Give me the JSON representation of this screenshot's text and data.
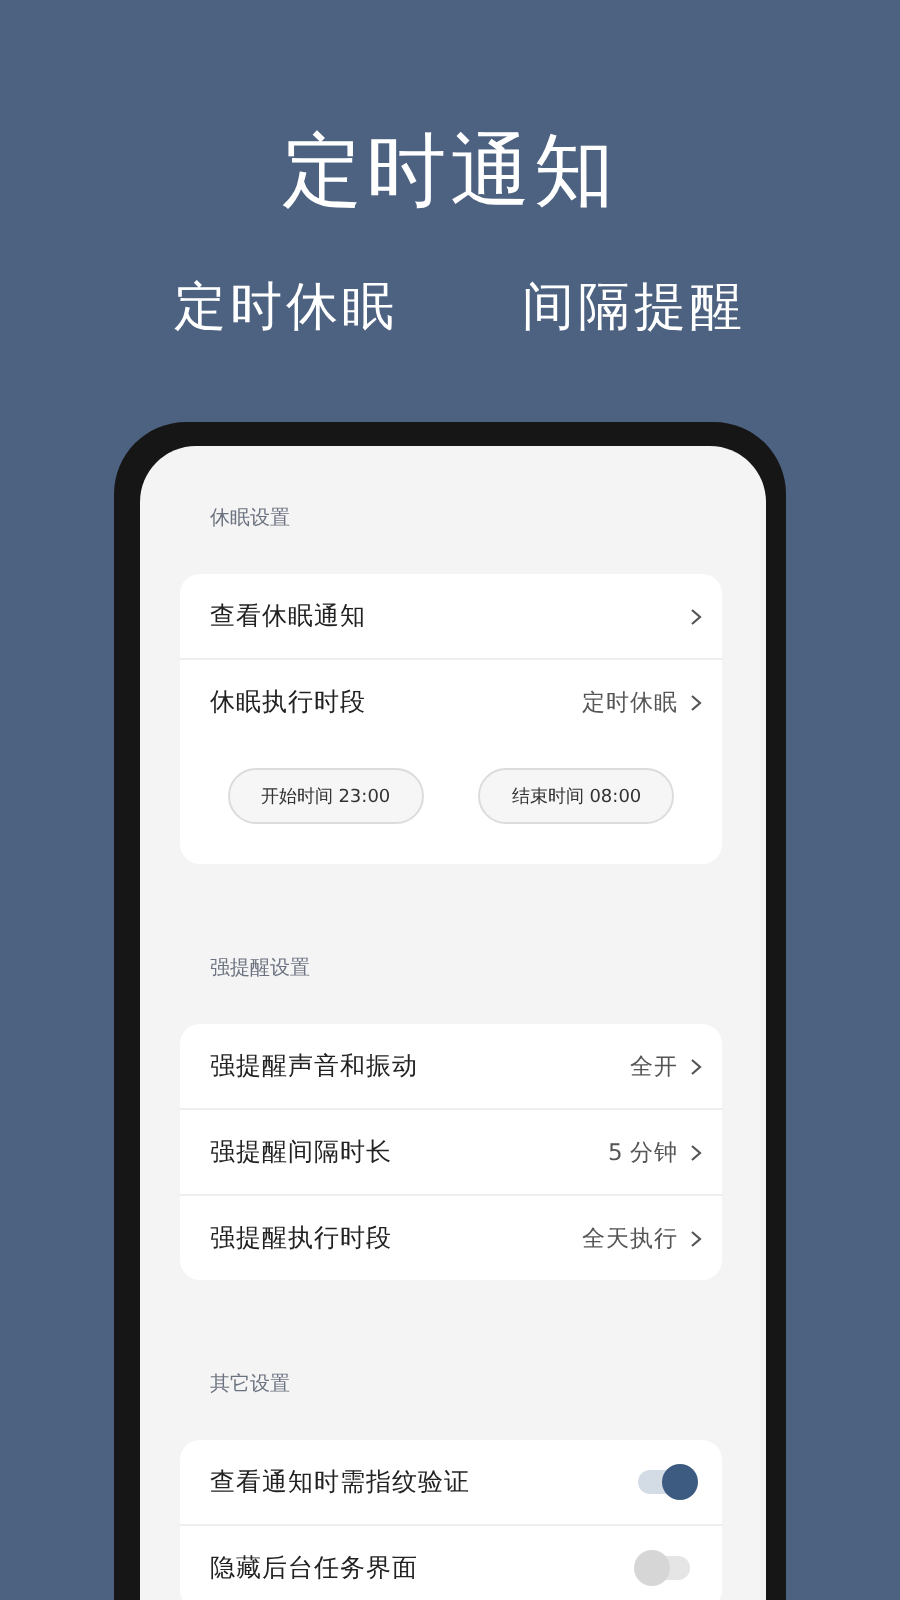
{
  "headline": "定时通知",
  "subtitles": [
    "定时休眠",
    "间隔提醒"
  ],
  "sections": [
    {
      "title": "休眠设置",
      "rows": [
        {
          "kind": "nav",
          "label": "查看休眠通知"
        },
        {
          "kind": "nav",
          "label": "休眠执行时段",
          "value": "定时休眠"
        }
      ],
      "times": [
        "开始时间 23:00",
        "结束时间 08:00"
      ]
    },
    {
      "title": "强提醒设置",
      "rows": [
        {
          "kind": "nav",
          "label": "强提醒声音和振动",
          "value": "全开"
        },
        {
          "kind": "nav",
          "label": "强提醒间隔时长",
          "value": "5 分钟"
        },
        {
          "kind": "nav",
          "label": "强提醒执行时段",
          "value": "全天执行"
        }
      ]
    },
    {
      "title": "其它设置",
      "rows": [
        {
          "kind": "toggle",
          "label": "查看通知时需指纹验证",
          "on": true
        },
        {
          "kind": "toggle",
          "label": "隐藏后台任务界面",
          "on": false
        }
      ]
    }
  ]
}
